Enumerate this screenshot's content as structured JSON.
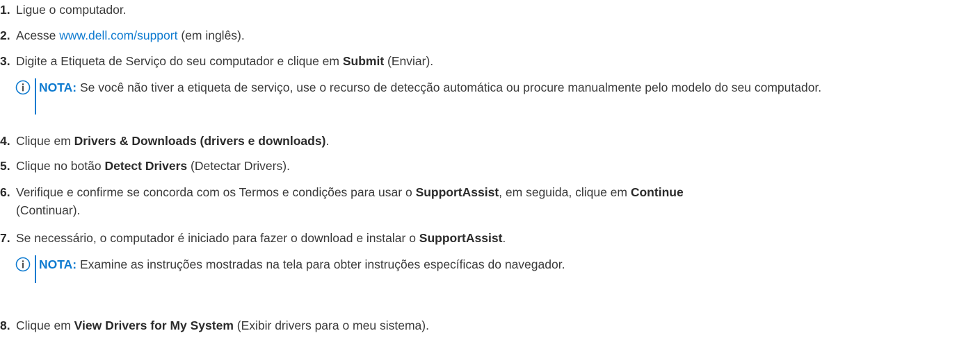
{
  "steps": [
    {
      "num": "1.",
      "text": "Ligue o computador."
    },
    {
      "num": "2.",
      "prefix": "Acesse ",
      "link": "www.dell.com/support",
      "suffix": " (em inglês)."
    },
    {
      "num": "3.",
      "prefix": "Digite a Etiqueta de Serviço do seu computador e clique em ",
      "bold": "Submit",
      "suffix": " (Enviar)."
    },
    {
      "num": "4.",
      "prefix": "Clique em ",
      "bold": "Drivers & Downloads (drivers e downloads)",
      "suffix": "."
    },
    {
      "num": "5.",
      "prefix": "Clique no botão ",
      "bold": "Detect Drivers",
      "suffix": " (Detectar Drivers)."
    },
    {
      "num": "6.",
      "prefix": "Verifique e confirme se concorda com os Termos e condições para usar o ",
      "bold": "SupportAssist",
      "mid": ", em seguida, clique em ",
      "bold2": "Continue",
      "suffix": "(Continuar)."
    },
    {
      "num": "7.",
      "prefix": "Se necessário, o computador é iniciado para fazer o download e instalar o ",
      "bold": "SupportAssist",
      "suffix": "."
    },
    {
      "num": "8.",
      "prefix": "Clique em ",
      "bold": "View Drivers for My System",
      "suffix": " (Exibir drivers para o meu sistema)."
    }
  ],
  "notes": [
    {
      "label": "NOTA:",
      "text": " Se você não tiver a etiqueta de serviço, use o recurso de detecção automática ou procure manualmente pelo modelo do seu computador."
    },
    {
      "label": "NOTA:",
      "text": " Examine as instruções mostradas na tela para obter instruções específicas do navegador."
    }
  ],
  "colors": {
    "accent": "#0f7bd0",
    "text": "#3a3a3a"
  },
  "icons": {
    "note": "info-circle-icon"
  }
}
